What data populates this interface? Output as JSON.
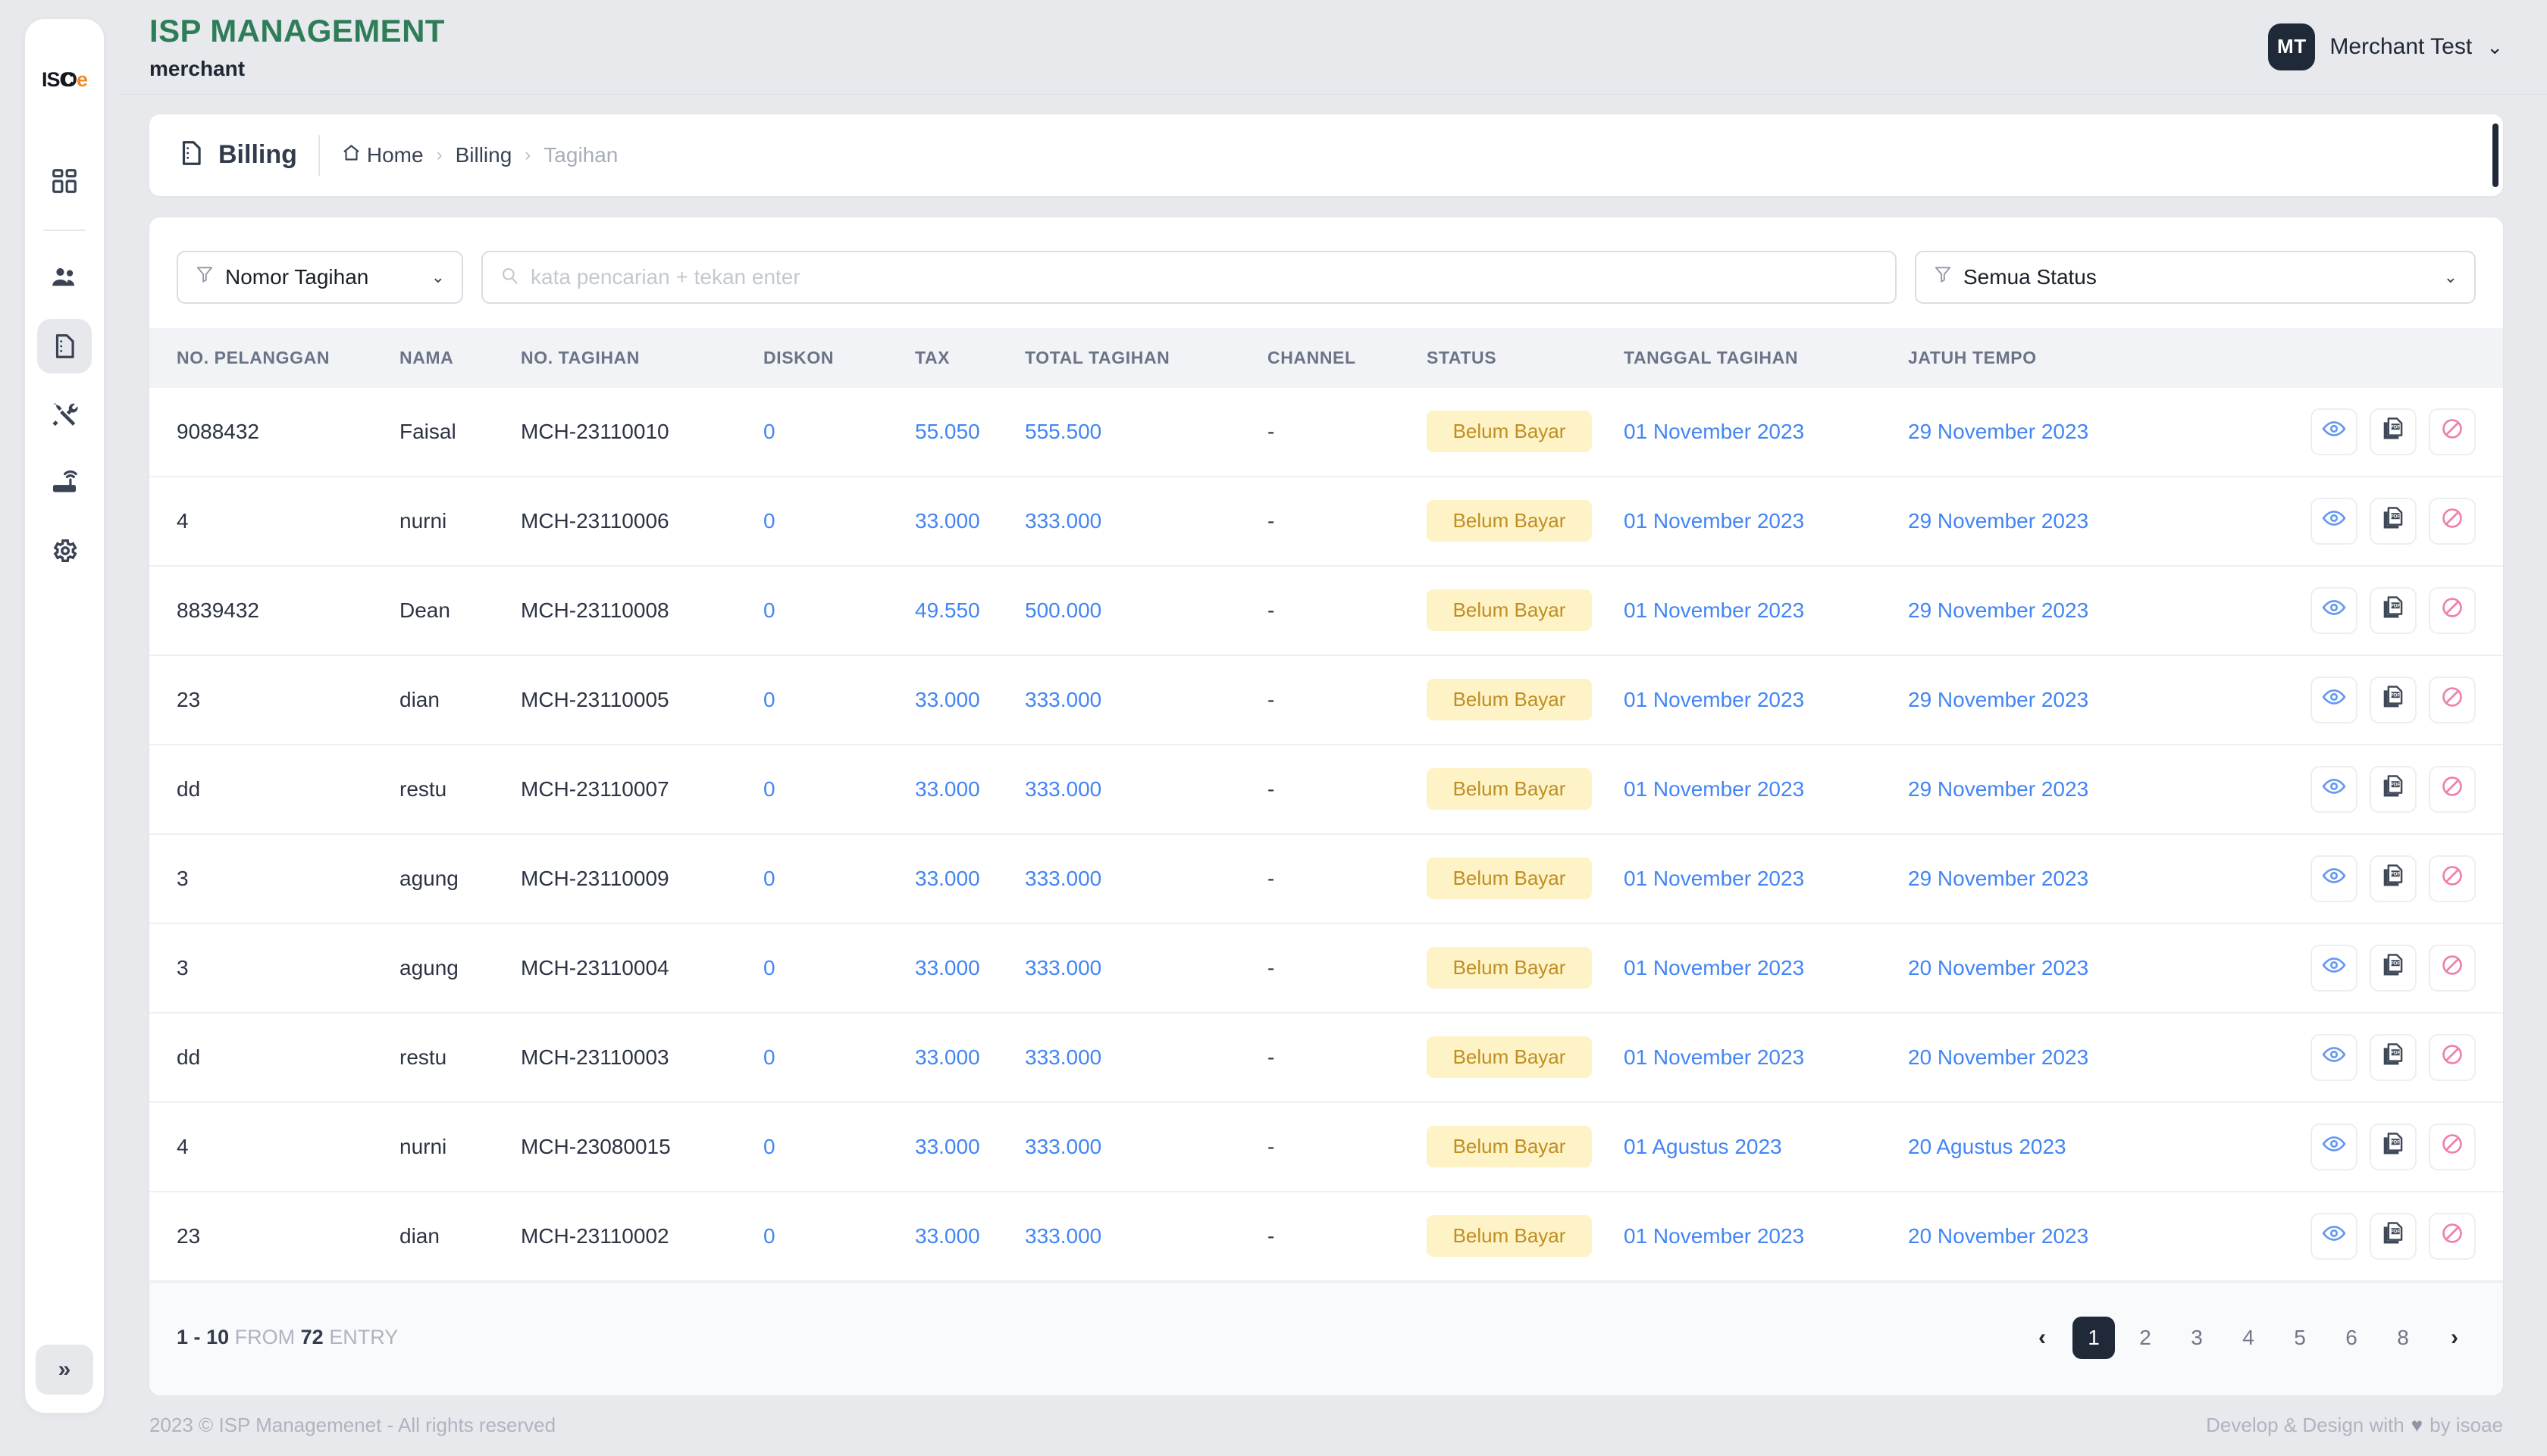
{
  "brand": {
    "logo_text_1": "ISC",
    "logo_text_2": "e",
    "logo_overlap": "O"
  },
  "header": {
    "app_title": "ISP MANAGEMENT",
    "app_subtitle": "merchant",
    "user_initials": "MT",
    "user_name": "Merchant Test",
    "caret": "⌄"
  },
  "sidebar": {
    "items": [
      {
        "name": "dashboard",
        "icon": "dashboard-grid-icon"
      },
      {
        "name": "customers",
        "icon": "users-icon"
      },
      {
        "name": "billing",
        "icon": "document-icon",
        "active": true
      },
      {
        "name": "tools",
        "icon": "tools-icon"
      },
      {
        "name": "devices",
        "icon": "router-icon"
      },
      {
        "name": "settings",
        "icon": "gear-icon"
      }
    ],
    "collapse_label": "»"
  },
  "page": {
    "title": "Billing",
    "breadcrumb": [
      {
        "label": "Home",
        "muted": false,
        "icon": "home-icon"
      },
      {
        "label": "Billing",
        "muted": false
      },
      {
        "label": "Tagihan",
        "muted": true
      }
    ],
    "breadcrumb_separator": "›"
  },
  "filters": {
    "left_select_value": "Nomor Tagihan",
    "left_select_icon": "filter-icon",
    "search_placeholder": "kata pencarian + tekan enter",
    "search_value": "",
    "search_icon": "search-icon",
    "right_select_value": "Semua Status",
    "right_select_icon": "filter-icon",
    "chevron": "⌄"
  },
  "table": {
    "columns": [
      "NO. PELANGGAN",
      "NAMA",
      "NO. TAGIHAN",
      "DISKON",
      "TAX",
      "TOTAL TAGIHAN",
      "CHANNEL",
      "STATUS",
      "TANGGAL TAGIHAN",
      "JATUH TEMPO"
    ],
    "rows": [
      {
        "no_pelanggan": "9088432",
        "nama": "Faisal",
        "no_tagihan": "MCH-23110010",
        "diskon": "0",
        "tax": "55.050",
        "total": "555.500",
        "channel": "-",
        "status": "Belum Bayar",
        "tanggal": "01 November 2023",
        "jatuh_tempo": "29 November 2023"
      },
      {
        "no_pelanggan": "4",
        "nama": "nurni",
        "no_tagihan": "MCH-23110006",
        "diskon": "0",
        "tax": "33.000",
        "total": "333.000",
        "channel": "-",
        "status": "Belum Bayar",
        "tanggal": "01 November 2023",
        "jatuh_tempo": "29 November 2023"
      },
      {
        "no_pelanggan": "8839432",
        "nama": "Dean",
        "no_tagihan": "MCH-23110008",
        "diskon": "0",
        "tax": "49.550",
        "total": "500.000",
        "channel": "-",
        "status": "Belum Bayar",
        "tanggal": "01 November 2023",
        "jatuh_tempo": "29 November 2023"
      },
      {
        "no_pelanggan": "23",
        "nama": "dian",
        "no_tagihan": "MCH-23110005",
        "diskon": "0",
        "tax": "33.000",
        "total": "333.000",
        "channel": "-",
        "status": "Belum Bayar",
        "tanggal": "01 November 2023",
        "jatuh_tempo": "29 November 2023"
      },
      {
        "no_pelanggan": "dd",
        "nama": "restu",
        "no_tagihan": "MCH-23110007",
        "diskon": "0",
        "tax": "33.000",
        "total": "333.000",
        "channel": "-",
        "status": "Belum Bayar",
        "tanggal": "01 November 2023",
        "jatuh_tempo": "29 November 2023"
      },
      {
        "no_pelanggan": "3",
        "nama": "agung",
        "no_tagihan": "MCH-23110009",
        "diskon": "0",
        "tax": "33.000",
        "total": "333.000",
        "channel": "-",
        "status": "Belum Bayar",
        "tanggal": "01 November 2023",
        "jatuh_tempo": "29 November 2023"
      },
      {
        "no_pelanggan": "3",
        "nama": "agung",
        "no_tagihan": "MCH-23110004",
        "diskon": "0",
        "tax": "33.000",
        "total": "333.000",
        "channel": "-",
        "status": "Belum Bayar",
        "tanggal": "01 November 2023",
        "jatuh_tempo": "20 November 2023"
      },
      {
        "no_pelanggan": "dd",
        "nama": "restu",
        "no_tagihan": "MCH-23110003",
        "diskon": "0",
        "tax": "33.000",
        "total": "333.000",
        "channel": "-",
        "status": "Belum Bayar",
        "tanggal": "01 November 2023",
        "jatuh_tempo": "20 November 2023"
      },
      {
        "no_pelanggan": "4",
        "nama": "nurni",
        "no_tagihan": "MCH-23080015",
        "diskon": "0",
        "tax": "33.000",
        "total": "333.000",
        "channel": "-",
        "status": "Belum Bayar",
        "tanggal": "01 Agustus 2023",
        "jatuh_tempo": "20 Agustus 2023"
      },
      {
        "no_pelanggan": "23",
        "nama": "dian",
        "no_tagihan": "MCH-23110002",
        "diskon": "0",
        "tax": "33.000",
        "total": "333.000",
        "channel": "-",
        "status": "Belum Bayar",
        "tanggal": "01 November 2023",
        "jatuh_tempo": "20 November 2023"
      }
    ],
    "row_actions": [
      {
        "name": "view-button",
        "icon": "eye-icon"
      },
      {
        "name": "download-pdf-button",
        "icon": "pdf-icon"
      },
      {
        "name": "cancel-button",
        "icon": "prohibited-icon"
      }
    ]
  },
  "pagination": {
    "range_start": "1",
    "range_dash": "-",
    "range_end": "10",
    "from_label": "FROM",
    "total": "72",
    "entry_label": "ENTRY",
    "prev": "‹",
    "next": "›",
    "pages": [
      "1",
      "2",
      "3",
      "4",
      "5",
      "6",
      "8"
    ],
    "active_page": "1"
  },
  "footer": {
    "left": "2023 © ISP Managemenet - All rights reserved",
    "right_pre": "Develop & Design with",
    "heart": "♥",
    "right_post": "by isoae"
  },
  "colors": {
    "brand_green": "#2f7d58",
    "brand_orange": "#ef8b2c",
    "link_blue": "#4285f4",
    "badge_bg": "#fdf3c7",
    "badge_text": "#c08e22",
    "dark": "#1f2937"
  }
}
